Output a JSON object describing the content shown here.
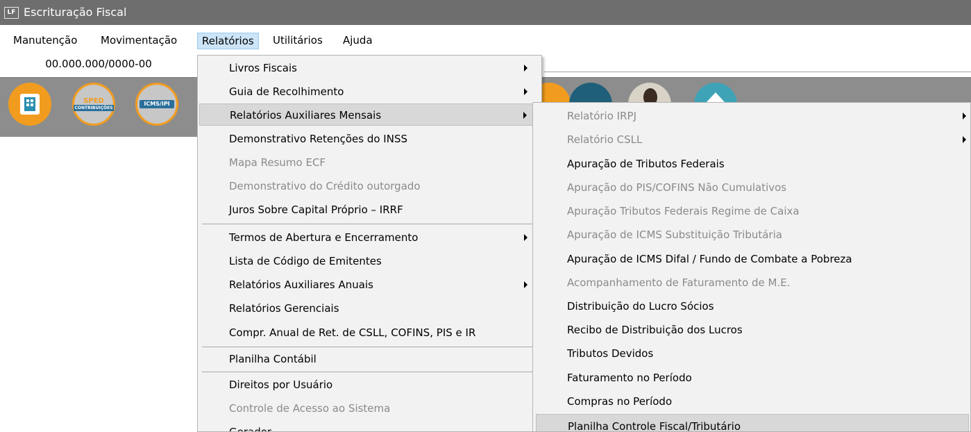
{
  "window": {
    "app_icon": "LF",
    "title": "Escrituração Fiscal"
  },
  "menubar": {
    "items": [
      {
        "label": "Manutenção"
      },
      {
        "label": "Movimentação"
      },
      {
        "label": "Relatórios"
      },
      {
        "label": "Utilitários"
      },
      {
        "label": "Ajuda"
      }
    ],
    "active_item": "Relatórios"
  },
  "company": {
    "cnpj": "00.000.000/0000-00"
  },
  "toolbar": {
    "icons": [
      {
        "name": "building-icon"
      },
      {
        "name": "sped-contribuicoes-icon",
        "line1": "SPED",
        "line2": "CONTRIBUIÇÕES"
      },
      {
        "name": "icms-ipi-icon",
        "label": "ICMS/IPI"
      },
      {
        "name": "orange-icon"
      },
      {
        "name": "navy-icon"
      },
      {
        "name": "user-photo-icon"
      },
      {
        "name": "teal-icon"
      }
    ]
  },
  "relatorios_menu": {
    "items": [
      {
        "label": "Livros Fiscais",
        "submenu": true,
        "disabled": false
      },
      {
        "label": "Guia de Recolhimento",
        "submenu": true,
        "disabled": false
      },
      {
        "label": "Relatórios Auxiliares Mensais",
        "submenu": true,
        "disabled": false,
        "highlighted": true
      },
      {
        "label": "Demonstrativo Retenções do INSS",
        "submenu": false,
        "disabled": false
      },
      {
        "label": "Mapa Resumo ECF",
        "submenu": false,
        "disabled": true
      },
      {
        "label": "Demonstrativo do Crédito outorgado",
        "submenu": false,
        "disabled": true
      },
      {
        "label": "Juros Sobre Capital Próprio – IRRF",
        "submenu": false,
        "disabled": false
      },
      {
        "label": "Termos de Abertura e Encerramento",
        "submenu": true,
        "disabled": false
      },
      {
        "label": "Lista de Código de Emitentes",
        "submenu": false,
        "disabled": false
      },
      {
        "label": "Relatórios Auxiliares Anuais",
        "submenu": true,
        "disabled": false
      },
      {
        "label": "Relatórios Gerenciais",
        "submenu": false,
        "disabled": false
      },
      {
        "label": "Compr. Anual de Ret. de CSLL, COFINS, PIS e IR",
        "submenu": false,
        "disabled": false
      },
      {
        "label": "Planilha Contábil",
        "submenu": false,
        "disabled": false
      },
      {
        "label": "Direitos por Usuário",
        "submenu": false,
        "disabled": false
      },
      {
        "label": "Controle de Acesso ao Sistema",
        "submenu": false,
        "disabled": true
      },
      {
        "label": "Gerador",
        "submenu": false,
        "disabled": false
      }
    ]
  },
  "submenu_relatorios_auxiliares_mensais": {
    "items": [
      {
        "label": "Relatório IRPJ",
        "submenu": true,
        "disabled": true
      },
      {
        "label": "Relatório CSLL",
        "submenu": true,
        "disabled": true
      },
      {
        "label": "Apuração de Tributos Federais",
        "submenu": false,
        "disabled": false
      },
      {
        "label": "Apuração do PIS/COFINS Não Cumulativos",
        "submenu": false,
        "disabled": true
      },
      {
        "label": "Apuração Tributos Federais Regime de Caixa",
        "submenu": false,
        "disabled": true
      },
      {
        "label": "Apuração de ICMS Substituição Tributária",
        "submenu": false,
        "disabled": true
      },
      {
        "label": "Apuração de ICMS Difal / Fundo de Combate a Pobreza",
        "submenu": false,
        "disabled": false
      },
      {
        "label": "Acompanhamento de Faturamento de M.E.",
        "submenu": false,
        "disabled": true
      },
      {
        "label": "Distribuição do Lucro Sócios",
        "submenu": false,
        "disabled": false
      },
      {
        "label": "Recibo de Distribuição dos Lucros",
        "submenu": false,
        "disabled": false
      },
      {
        "label": "Tributos Devidos",
        "submenu": false,
        "disabled": false
      },
      {
        "label": "Faturamento no Período",
        "submenu": false,
        "disabled": false
      },
      {
        "label": "Compras no Período",
        "submenu": false,
        "disabled": false
      },
      {
        "label": "Planilha Controle Fiscal/Tributário",
        "submenu": false,
        "disabled": false,
        "highlighted": true
      }
    ]
  },
  "colors": {
    "titlebar": "#6e6e6e",
    "toolbar": "#8d8d8d",
    "menu_background": "#f2f2f2",
    "menu_highlight": "#d8d8d8",
    "active_menubar": "#cce4f7",
    "disabled_text": "#8a8a8a",
    "icon_orange": "#f29c1f"
  }
}
